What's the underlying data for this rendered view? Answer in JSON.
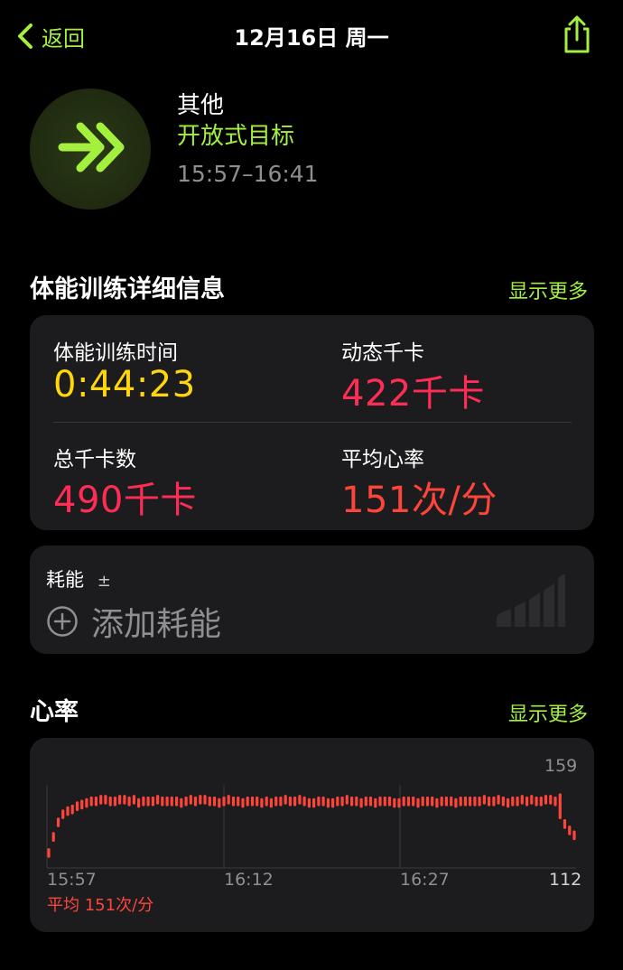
{
  "nav": {
    "back_label": "返回",
    "title": "12月16日 周一"
  },
  "workout": {
    "type": "其他",
    "goal": "开放式目标",
    "time_range": "15:57–16:41"
  },
  "details": {
    "section_title": "体能训练详细信息",
    "show_more": "显示更多",
    "metrics": [
      {
        "label": "体能训练时间",
        "value": "0:44:23",
        "color": "#ffd60a"
      },
      {
        "label": "动态千卡",
        "value": "422千卡",
        "color": "#ff2d55"
      },
      {
        "label": "总千卡数",
        "value": "490千卡",
        "color": "#ff2d55"
      },
      {
        "label": "平均心率",
        "value": "151次/分",
        "color": "#ff453a"
      }
    ]
  },
  "effort": {
    "label": "耗能",
    "plusminus": "±",
    "add_label": "添加耗能"
  },
  "heart_rate": {
    "section_title": "心率",
    "show_more": "显示更多",
    "avg_label": "平均 151次/分"
  },
  "chart_data": {
    "type": "bar",
    "title": "心率",
    "x_ticks": [
      "15:57",
      "16:12",
      "16:27"
    ],
    "y_max_label": "159",
    "y_min_label": "112",
    "ylim": [
      112,
      159
    ],
    "color": "#ff453a",
    "ranges": [
      [
        116,
        122
      ],
      [
        126,
        132
      ],
      [
        135,
        141
      ],
      [
        140,
        146
      ],
      [
        142,
        148
      ],
      [
        143,
        149
      ],
      [
        145,
        151
      ],
      [
        146,
        152
      ],
      [
        147,
        153
      ],
      [
        148,
        154
      ],
      [
        148,
        154
      ],
      [
        149,
        155
      ],
      [
        149,
        155
      ],
      [
        148,
        154
      ],
      [
        148,
        154
      ],
      [
        149,
        155
      ],
      [
        149,
        155
      ],
      [
        148,
        154
      ],
      [
        149,
        155
      ],
      [
        147,
        153
      ],
      [
        148,
        154
      ],
      [
        148,
        154
      ],
      [
        148,
        154
      ],
      [
        149,
        155
      ],
      [
        148,
        154
      ],
      [
        148,
        154
      ],
      [
        148,
        154
      ],
      [
        148,
        154
      ],
      [
        147,
        153
      ],
      [
        148,
        154
      ],
      [
        149,
        155
      ],
      [
        148,
        154
      ],
      [
        149,
        155
      ],
      [
        149,
        155
      ],
      [
        148,
        154
      ],
      [
        148,
        154
      ],
      [
        147,
        153
      ],
      [
        148,
        154
      ],
      [
        149,
        155
      ],
      [
        148,
        154
      ],
      [
        148,
        154
      ],
      [
        147,
        153
      ],
      [
        148,
        154
      ],
      [
        148,
        154
      ],
      [
        148,
        154
      ],
      [
        147,
        153
      ],
      [
        148,
        154
      ],
      [
        147,
        153
      ],
      [
        148,
        154
      ],
      [
        148,
        154
      ],
      [
        149,
        155
      ],
      [
        148,
        154
      ],
      [
        148,
        154
      ],
      [
        149,
        155
      ],
      [
        148,
        154
      ],
      [
        147,
        153
      ],
      [
        147,
        153
      ],
      [
        148,
        154
      ],
      [
        148,
        154
      ],
      [
        147,
        153
      ],
      [
        147,
        153
      ],
      [
        148,
        154
      ],
      [
        148,
        154
      ],
      [
        149,
        155
      ],
      [
        148,
        154
      ],
      [
        148,
        154
      ],
      [
        147,
        153
      ],
      [
        148,
        154
      ],
      [
        148,
        154
      ],
      [
        147,
        153
      ],
      [
        148,
        154
      ],
      [
        148,
        154
      ],
      [
        148,
        154
      ],
      [
        147,
        153
      ],
      [
        147,
        153
      ],
      [
        148,
        154
      ],
      [
        148,
        154
      ],
      [
        148,
        154
      ],
      [
        147,
        153
      ],
      [
        148,
        154
      ],
      [
        148,
        154
      ],
      [
        148,
        154
      ],
      [
        147,
        153
      ],
      [
        148,
        154
      ],
      [
        148,
        154
      ],
      [
        148,
        154
      ],
      [
        147,
        153
      ],
      [
        148,
        154
      ],
      [
        148,
        154
      ],
      [
        148,
        154
      ],
      [
        148,
        154
      ],
      [
        148,
        154
      ],
      [
        149,
        155
      ],
      [
        148,
        154
      ],
      [
        148,
        154
      ],
      [
        149,
        155
      ],
      [
        148,
        154
      ],
      [
        147,
        153
      ],
      [
        148,
        154
      ],
      [
        148,
        154
      ],
      [
        149,
        155
      ],
      [
        148,
        154
      ],
      [
        149,
        155
      ],
      [
        148,
        154
      ],
      [
        148,
        154
      ],
      [
        149,
        155
      ],
      [
        149,
        155
      ],
      [
        148,
        154
      ],
      [
        140,
        156
      ],
      [
        134,
        140
      ],
      [
        130,
        136
      ],
      [
        127,
        133
      ]
    ]
  }
}
